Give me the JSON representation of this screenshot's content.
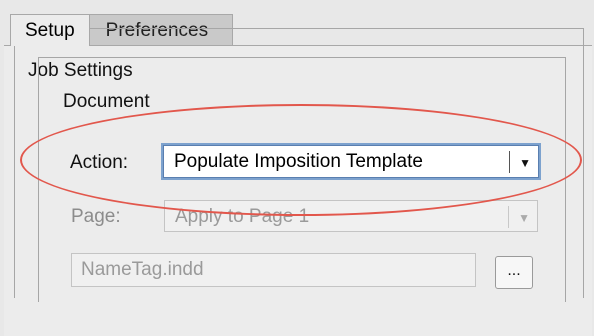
{
  "tabs": [
    {
      "label": "Setup",
      "active": true
    },
    {
      "label": "Preferences",
      "active": false
    }
  ],
  "groups": {
    "job_settings": "Job Settings",
    "document": "Document"
  },
  "action": {
    "label": "Action:",
    "value": "Populate Imposition Template"
  },
  "page": {
    "label": "Page:",
    "value": "Apply to Page 1"
  },
  "file": {
    "value": "NameTag.indd",
    "browse_label": "..."
  },
  "annotation": {
    "color": "#e2574c"
  },
  "colors": {
    "focus_ring": "#7da2ce",
    "disabled_text": "#9a9a9a"
  }
}
